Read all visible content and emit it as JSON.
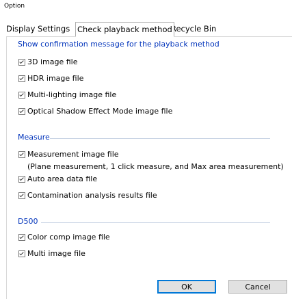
{
  "window": {
    "title": "Option"
  },
  "tabs": [
    {
      "label": "Display Settings"
    },
    {
      "label": "Check playback method"
    },
    {
      "label": "Recycle Bin"
    }
  ],
  "groups": {
    "confirmation": {
      "title": "Show confirmation message for the playback method",
      "items": [
        {
          "label": "3D image file",
          "checked": true
        },
        {
          "label": "HDR image file",
          "checked": true
        },
        {
          "label": "Multi-lighting image file",
          "checked": true
        },
        {
          "label": "Optical Shadow Effect Mode image file",
          "checked": true
        }
      ]
    },
    "measure": {
      "title": "Measure",
      "items": [
        {
          "label": "Measurement image file",
          "checked": true
        },
        {
          "label": "Auto area data file",
          "checked": true
        },
        {
          "label": "Contamination analysis results file",
          "checked": true
        }
      ],
      "note": "(Plane measurement, 1 click measure, and Max area measurement)"
    },
    "d500": {
      "title": "D500",
      "items": [
        {
          "label": "Color comp image file",
          "checked": true
        },
        {
          "label": "Multi image file",
          "checked": true
        }
      ]
    }
  },
  "buttons": {
    "ok": "OK",
    "cancel": "Cancel"
  },
  "colors": {
    "group_title": "#0033bb",
    "ok_border": "#0078d7"
  }
}
